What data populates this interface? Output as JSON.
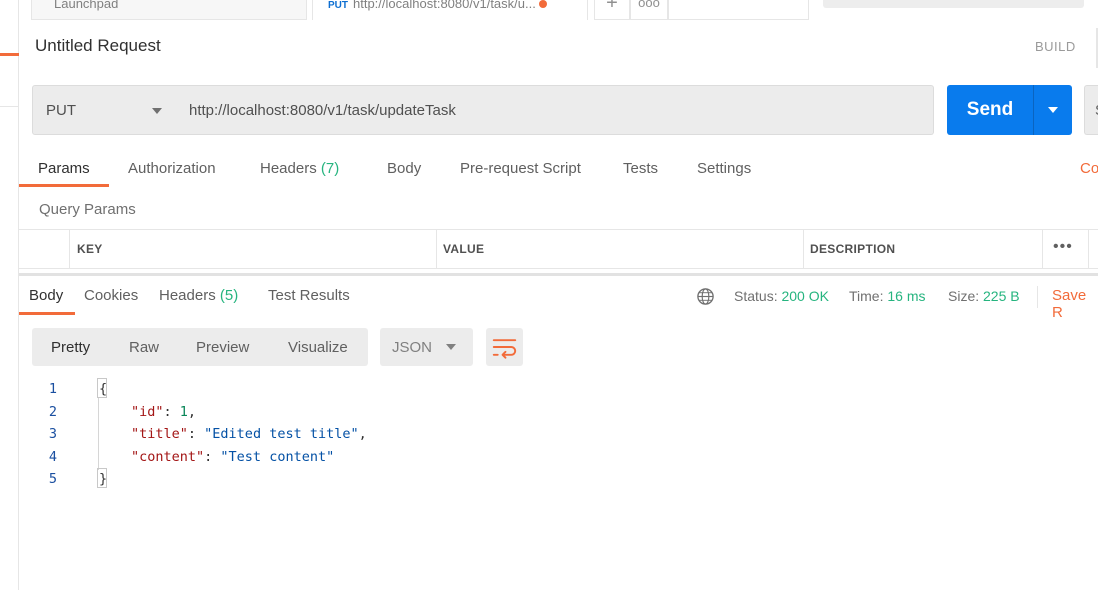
{
  "tabs": {
    "launchpad": "Launchpad",
    "active_method": "PUT",
    "active_title": "http://localhost:8080/v1/task/u...",
    "add": "+",
    "more": "ooo"
  },
  "request": {
    "title": "Untitled Request",
    "build": "BUILD",
    "method": "PUT",
    "url": "http://localhost:8080/v1/task/updateTask",
    "send": "Send",
    "save_stub": "S"
  },
  "request_tabs": {
    "params": "Params",
    "authorization": "Authorization",
    "headers": "Headers",
    "headers_count": "(7)",
    "body": "Body",
    "prerequest": "Pre-request Script",
    "tests": "Tests",
    "settings": "Settings",
    "cookies": "Co"
  },
  "query_params": {
    "title": "Query Params",
    "columns": [
      "KEY",
      "VALUE",
      "DESCRIPTION"
    ],
    "more": "•••"
  },
  "response_tabs": {
    "body": "Body",
    "cookies": "Cookies",
    "headers": "Headers",
    "headers_count": "(5)",
    "test_results": "Test Results"
  },
  "response_meta": {
    "status_label": "Status:",
    "status_value": "200 OK",
    "time_label": "Time:",
    "time_value": "16 ms",
    "size_label": "Size:",
    "size_value": "225 B",
    "save": "Save R"
  },
  "toolbar": {
    "formats": [
      "Pretty",
      "Raw",
      "Preview",
      "Visualize"
    ],
    "language": "JSON"
  },
  "code": {
    "line_numbers": [
      "1",
      "2",
      "3",
      "4",
      "5"
    ],
    "open_brace": "{",
    "close_brace": "}",
    "lines": [
      {
        "key": "\"id\"",
        "sep": ": ",
        "value": "1",
        "tail": ","
      },
      {
        "key": "\"title\"",
        "sep": ": ",
        "value": "\"Edited test title\"",
        "tail": ","
      },
      {
        "key": "\"content\"",
        "sep": ": ",
        "value": "\"Test content\"",
        "tail": ""
      }
    ]
  },
  "colors": {
    "accent": "#f26b3a",
    "send": "#097bed",
    "success": "#26b47f"
  }
}
